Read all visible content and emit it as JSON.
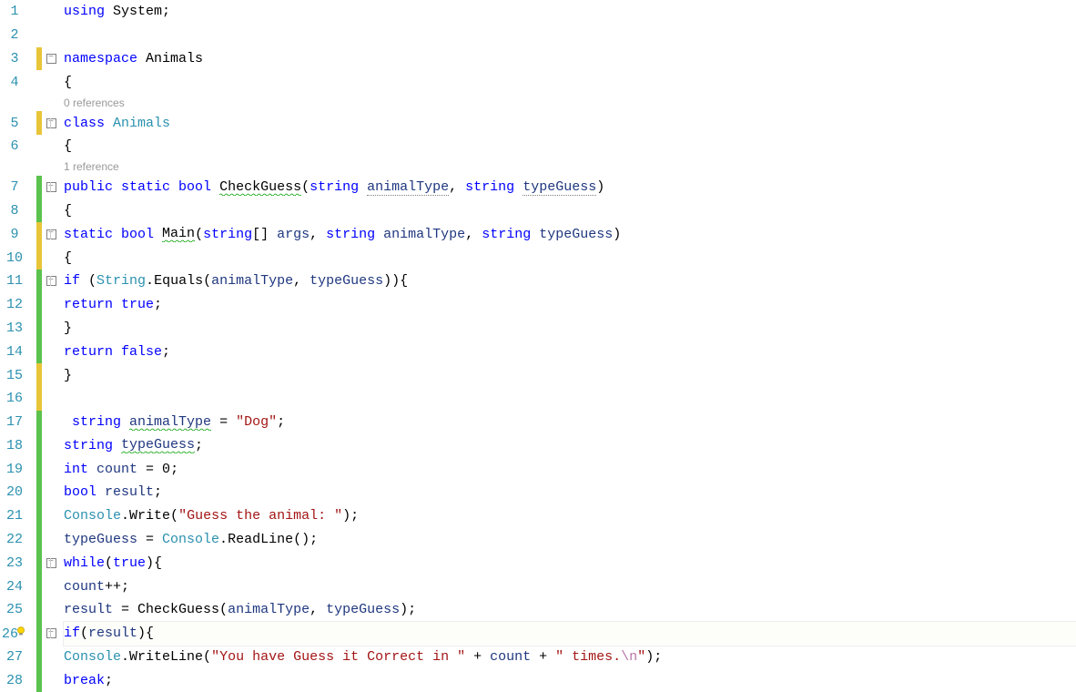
{
  "codelens": {
    "class": "0 references",
    "method": "1 reference"
  },
  "lines": [
    {
      "n": 1,
      "bar": "none",
      "fold": "",
      "indent": 0,
      "tokens": [
        [
          "kw",
          "using"
        ],
        [
          "ident",
          " System"
        ],
        [
          "punct",
          ";"
        ]
      ]
    },
    {
      "n": 2,
      "bar": "none",
      "fold": "line",
      "indent": 0,
      "tokens": []
    },
    {
      "n": 3,
      "bar": "yellow",
      "fold": "box",
      "indent": 0,
      "tokens": [
        [
          "kw",
          "namespace"
        ],
        [
          "ident",
          " Animals"
        ]
      ]
    },
    {
      "n": 4,
      "bar": "none",
      "fold": "line",
      "indent": 0,
      "tokens": [
        [
          "punct",
          "{"
        ]
      ]
    },
    {
      "n": 0,
      "bar": "none",
      "fold": "line",
      "indent": 1,
      "codelens": "class",
      "small": true
    },
    {
      "n": 5,
      "bar": "yellow",
      "fold": "boxl",
      "indent": 1,
      "tokens": [
        [
          "kw",
          "class"
        ],
        [
          "cls",
          " Animals"
        ]
      ]
    },
    {
      "n": 6,
      "bar": "none",
      "fold": "line",
      "indent": 1,
      "tokens": [
        [
          "punct",
          "{"
        ]
      ]
    },
    {
      "n": 0,
      "bar": "none",
      "fold": "line",
      "indent": 2,
      "codelens": "method",
      "small": true
    },
    {
      "n": 7,
      "bar": "green",
      "fold": "boxl",
      "indent": 2,
      "tokens": [
        [
          "kw",
          "public"
        ],
        [
          "kw",
          " static"
        ],
        [
          "kw",
          " bool"
        ],
        [
          "ident",
          " "
        ],
        [
          "ident squiggle-green",
          "CheckGuess"
        ],
        [
          "punct",
          "("
        ],
        [
          "kw",
          "string"
        ],
        [
          "ident",
          " "
        ],
        [
          "local dotted-u",
          "animalType"
        ],
        [
          "punct",
          ", "
        ],
        [
          "kw",
          "string"
        ],
        [
          "ident",
          " "
        ],
        [
          "local dotted-u",
          "typeGuess"
        ],
        [
          "punct",
          ")"
        ]
      ]
    },
    {
      "n": 8,
      "bar": "green",
      "fold": "line",
      "indent": 2,
      "tokens": [
        [
          "punct",
          "{"
        ]
      ]
    },
    {
      "n": 9,
      "bar": "yellow",
      "fold": "boxl",
      "indent": 3,
      "tokens": [
        [
          "kw",
          "static"
        ],
        [
          "kw",
          " bool"
        ],
        [
          "ident",
          " "
        ],
        [
          "ident squiggle-green",
          "Main"
        ],
        [
          "punct",
          "("
        ],
        [
          "kw",
          "string"
        ],
        [
          "punct",
          "[] "
        ],
        [
          "local",
          "args"
        ],
        [
          "punct",
          ", "
        ],
        [
          "kw",
          "string"
        ],
        [
          "local",
          " animalType"
        ],
        [
          "punct",
          ", "
        ],
        [
          "kw",
          "string"
        ],
        [
          "local",
          " typeGuess"
        ],
        [
          "punct",
          ")"
        ]
      ]
    },
    {
      "n": 10,
      "bar": "yellow",
      "fold": "line",
      "indent": 2,
      "tokens": [
        [
          "punct",
          "{"
        ]
      ]
    },
    {
      "n": 11,
      "bar": "green",
      "fold": "boxl",
      "indent": 3,
      "tokens": [
        [
          "kw",
          "if"
        ],
        [
          "punct",
          " ("
        ],
        [
          "cls",
          "String"
        ],
        [
          "punct",
          "."
        ],
        [
          "ident",
          "Equals"
        ],
        [
          "punct",
          "("
        ],
        [
          "local",
          "animalType"
        ],
        [
          "punct",
          ", "
        ],
        [
          "local",
          "typeGuess"
        ],
        [
          "punct",
          ")){"
        ]
      ]
    },
    {
      "n": 12,
      "bar": "green",
      "fold": "line",
      "indent": 4,
      "tokens": [
        [
          "kw",
          "return"
        ],
        [
          "kw",
          " true"
        ],
        [
          "punct",
          ";"
        ]
      ]
    },
    {
      "n": 13,
      "bar": "green",
      "fold": "line",
      "indent": 3,
      "tokens": [
        [
          "punct",
          "}"
        ]
      ]
    },
    {
      "n": 14,
      "bar": "green",
      "fold": "line",
      "indent": 3,
      "tokens": [
        [
          "kw",
          "return"
        ],
        [
          "kw",
          " false"
        ],
        [
          "punct",
          ";"
        ]
      ]
    },
    {
      "n": 15,
      "bar": "yellow",
      "fold": "line",
      "indent": 2,
      "tokens": [
        [
          "punct",
          "}"
        ]
      ]
    },
    {
      "n": 16,
      "bar": "yellow",
      "fold": "line",
      "indent": 2,
      "tokens": []
    },
    {
      "n": 17,
      "bar": "green",
      "fold": "line",
      "indent": 3,
      "tokens": [
        [
          "ident",
          " "
        ],
        [
          "kw",
          "string"
        ],
        [
          "ident",
          " "
        ],
        [
          "local squiggle-green",
          "animalType"
        ],
        [
          "punct",
          " = "
        ],
        [
          "str",
          "\"Dog\""
        ],
        [
          "punct",
          ";"
        ]
      ]
    },
    {
      "n": 18,
      "bar": "green",
      "fold": "line",
      "indent": 2,
      "tokens": [
        [
          "kw",
          "string"
        ],
        [
          "ident",
          " "
        ],
        [
          "local squiggle-green",
          "typeGuess"
        ],
        [
          "punct",
          ";"
        ]
      ]
    },
    {
      "n": 19,
      "bar": "green",
      "fold": "line",
      "indent": 2,
      "tokens": [
        [
          "kw",
          "int"
        ],
        [
          "local",
          " count"
        ],
        [
          "punct",
          " = "
        ],
        [
          "ident",
          "0"
        ],
        [
          "punct",
          ";"
        ]
      ]
    },
    {
      "n": 20,
      "bar": "green",
      "fold": "line",
      "indent": 2,
      "tokens": [
        [
          "kw",
          "bool"
        ],
        [
          "local",
          " result"
        ],
        [
          "punct",
          ";"
        ]
      ]
    },
    {
      "n": 21,
      "bar": "green",
      "fold": "line",
      "indent": 2,
      "tokens": [
        [
          "cls",
          "Console"
        ],
        [
          "punct",
          "."
        ],
        [
          "ident",
          "Write"
        ],
        [
          "punct",
          "("
        ],
        [
          "str",
          "\"Guess the animal: \""
        ],
        [
          "punct",
          ");"
        ]
      ]
    },
    {
      "n": 22,
      "bar": "green",
      "fold": "line",
      "indent": 1,
      "tokens": [
        [
          "local",
          "typeGuess"
        ],
        [
          "punct",
          " = "
        ],
        [
          "cls",
          "Console"
        ],
        [
          "punct",
          "."
        ],
        [
          "ident",
          "ReadLine"
        ],
        [
          "punct",
          "();"
        ]
      ]
    },
    {
      "n": 23,
      "bar": "green",
      "fold": "boxl",
      "indent": 3,
      "tokens": [
        [
          "kw",
          "while"
        ],
        [
          "punct",
          "("
        ],
        [
          "kw",
          "true"
        ],
        [
          "punct",
          "){"
        ]
      ]
    },
    {
      "n": 24,
      "bar": "green",
      "fold": "line",
      "indent": 3,
      "tokens": [
        [
          "local",
          "count"
        ],
        [
          "punct",
          "++;"
        ]
      ]
    },
    {
      "n": 25,
      "bar": "green",
      "fold": "line",
      "indent": 3,
      "tokens": [
        [
          "local",
          "result"
        ],
        [
          "punct",
          " = "
        ],
        [
          "ident",
          "CheckGuess"
        ],
        [
          "punct",
          "("
        ],
        [
          "local",
          "animalType"
        ],
        [
          "punct",
          ", "
        ],
        [
          "local",
          "typeGuess"
        ],
        [
          "punct",
          ");"
        ]
      ]
    },
    {
      "n": 26,
      "bar": "green",
      "fold": "boxl",
      "indent": 2,
      "lightbulb": true,
      "highlight": true,
      "tokens": [
        [
          "kw",
          "if"
        ],
        [
          "punct",
          "("
        ],
        [
          "local",
          "result"
        ],
        [
          "punct",
          "){"
        ]
      ]
    },
    {
      "n": 27,
      "bar": "green",
      "fold": "line",
      "indent": 3,
      "tokens": [
        [
          "cls",
          "Console"
        ],
        [
          "punct",
          "."
        ],
        [
          "ident",
          "WriteLine"
        ],
        [
          "punct",
          "("
        ],
        [
          "str",
          "\"You have Guess it Correct in \""
        ],
        [
          "punct",
          " + "
        ],
        [
          "local",
          "count"
        ],
        [
          "punct",
          " + "
        ],
        [
          "str",
          "\" times."
        ],
        [
          "esc",
          "\\n"
        ],
        [
          "str",
          "\""
        ],
        [
          "punct",
          ");"
        ]
      ]
    },
    {
      "n": 28,
      "bar": "green",
      "fold": "line",
      "indent": 3,
      "tokens": [
        [
          "kw",
          "break"
        ],
        [
          "punct",
          ";"
        ]
      ]
    }
  ]
}
